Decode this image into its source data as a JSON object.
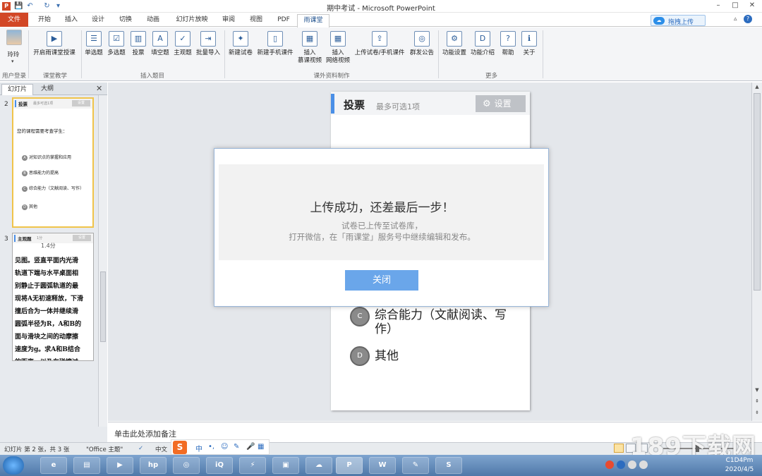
{
  "window": {
    "title": "期中考试 - Microsoft PowerPoint",
    "app_badge": "P",
    "quick_access": [
      "💾",
      "↶",
      "↻",
      "▾"
    ],
    "controls": [
      "–",
      "□",
      "✕"
    ]
  },
  "ribbon_tabs": [
    "文件",
    "开始",
    "插入",
    "设计",
    "切换",
    "动画",
    "幻灯片放映",
    "审阅",
    "视图",
    "PDF",
    "雨课堂"
  ],
  "upload_button": "拖拽上传",
  "help_icons": [
    "▵",
    "?"
  ],
  "ribbon": {
    "user": {
      "name": "玲玲",
      "group": "用户登录"
    },
    "teaching": {
      "button": "开启雨课堂授课",
      "group": "课堂教学"
    },
    "questions": {
      "buttons": [
        "单选题",
        "多选题",
        "投票",
        "填空题",
        "主观题",
        "批量导入"
      ],
      "group": "插入题目"
    },
    "materials": {
      "buttons": [
        "新建试卷",
        "新建手机课件",
        "插入\n慕课视频",
        "插入\n网络视频",
        "上传试卷/手机课件",
        "群发公告"
      ],
      "group": "课外资料制作"
    },
    "more": {
      "buttons": [
        "功能设置",
        "功能介绍",
        "帮助",
        "关于"
      ],
      "group": "更多"
    }
  },
  "left_panel": {
    "tabs": [
      "幻灯片",
      "大纲"
    ],
    "close": "✕",
    "slides": [
      {
        "number": "2",
        "title": "投票",
        "subtitle": "最多可选1项",
        "settings": "设置",
        "question": "您的课程需要考查学生：",
        "options": [
          {
            "letter": "A",
            "text": "对知识点的掌握和应用"
          },
          {
            "letter": "B",
            "text": "思维能力的提高"
          },
          {
            "letter": "C",
            "text": "综合能力（文献阅读、写作）"
          },
          {
            "letter": "D",
            "text": "其他"
          }
        ]
      },
      {
        "number": "3",
        "title": "主观题",
        "subtitle": "1分",
        "settings": "设置",
        "top_text": "1.4分",
        "body": "见图。竖直平面内光滑\n轨道下端与水平桌面相\n别静止于圆弧轨道的最\n现将A无初速释放，下滑\n撞后合为一体并继续滑\n圆弧半径为R，A和B的\n面与滑块之间的动摩擦\n速度为g。求A和B结合\n的距离，以及在碰撞过"
      }
    ]
  },
  "slide": {
    "title": "投票",
    "subtitle": "最多可选1项",
    "settings_label": "设置",
    "options": [
      {
        "letter": "C",
        "text": "综合能力（文献阅读、写作）"
      },
      {
        "letter": "D",
        "text": "其他"
      }
    ]
  },
  "dialog": {
    "heading": "上传成功，还差最后一步！",
    "line1": "试卷已上传至试卷库，",
    "line2": "打开微信，在「雨课堂」服务号中继续编辑和发布。",
    "close_button": "关闭"
  },
  "notes": {
    "placeholder": "单击此处添加备注"
  },
  "status_bar": {
    "slide_info": "幻灯片 第 2 张，共 3 张",
    "theme": "\"Office 主题\"",
    "language": "中文"
  },
  "ime": {
    "logo": "S",
    "items": [
      "中",
      "•,",
      "☺",
      "✎",
      "🎤",
      "▦"
    ]
  },
  "watermark": "189下载网",
  "taskbar": {
    "apps": [
      "e",
      "▤",
      "▶",
      "hp",
      "◎",
      "iQ",
      "⚡",
      "▣",
      "☁",
      "P",
      "W",
      "✎",
      "S"
    ],
    "clock_time": "C1D4Pm",
    "clock_date": "2020/4/5"
  }
}
